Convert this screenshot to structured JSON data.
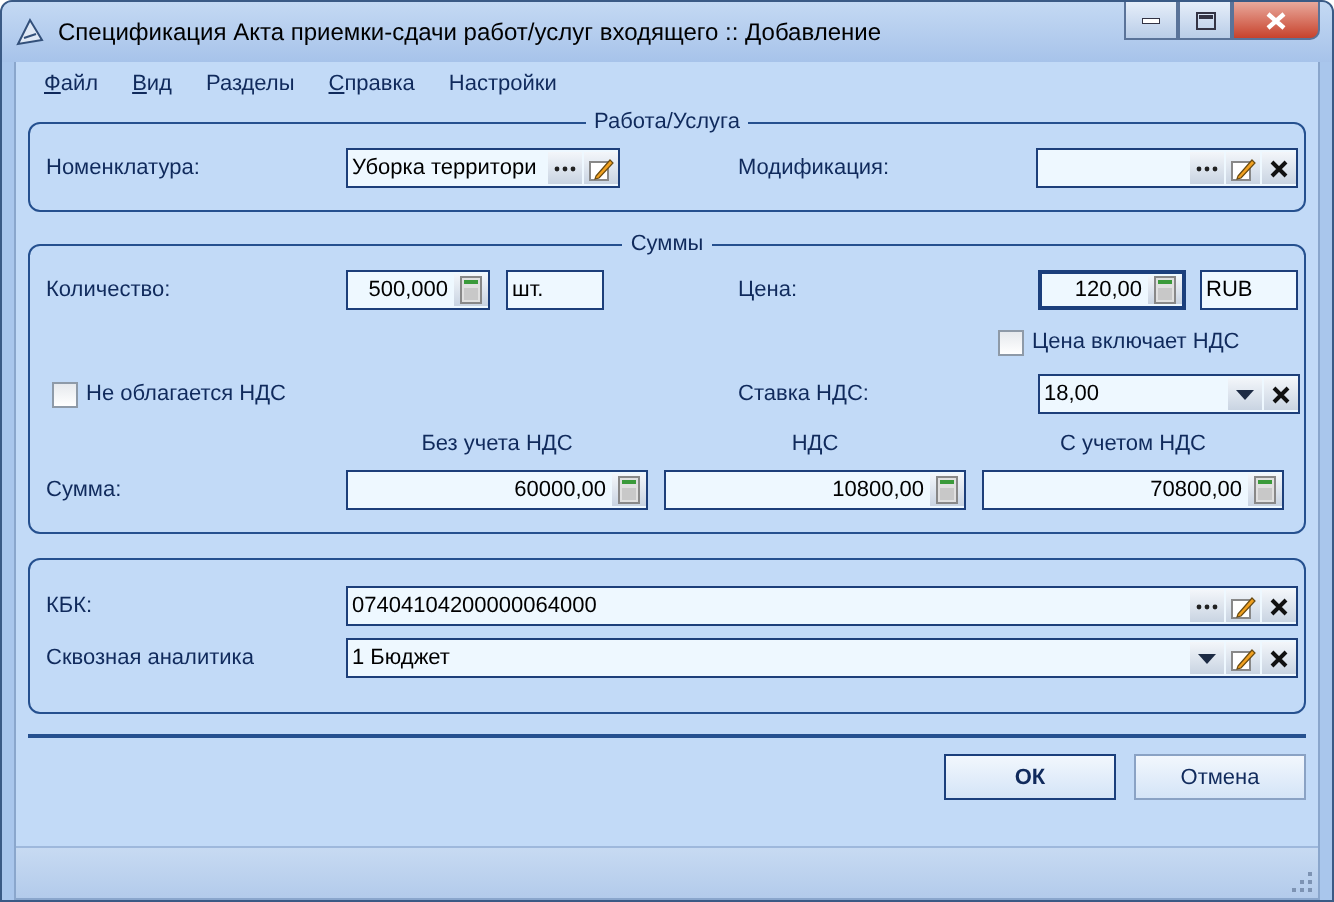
{
  "window": {
    "title": "Спецификация Акта приемки-сдачи работ/услуг входящего :: Добавление"
  },
  "menu": [
    {
      "label": "Файл",
      "underline_first": true
    },
    {
      "label": "Вид",
      "underline_first": true
    },
    {
      "label": "Разделы",
      "underline_first": false
    },
    {
      "label": "Справка",
      "underline_first": true
    },
    {
      "label": "Настройки",
      "underline_first": false
    }
  ],
  "work": {
    "title": "Работа/Услуга",
    "nomenclature": {
      "label": "Номенклатура:",
      "value": "Уборка территори",
      "buttons": [
        {
          "kind": "ellipsis"
        },
        {
          "kind": "edit"
        }
      ]
    },
    "modification": {
      "label": "Модификация:",
      "buttons": [
        {
          "kind": "ellipsis"
        },
        {
          "kind": "edit"
        },
        {
          "kind": "clear"
        }
      ]
    }
  },
  "sums": {
    "title": "Суммы",
    "quantity": {
      "label": "Количество:",
      "value": "500,000",
      "unit": "шт."
    },
    "price": {
      "label": "Цена:",
      "value": "120,00",
      "focused": true,
      "currency": "RUB"
    },
    "price_includes_vat": {
      "label": "Цена включает НДС",
      "checked": false
    },
    "vat_exempt": {
      "label": "Не облагается НДС",
      "checked": false
    },
    "vat_rate": {
      "label": "Ставка НДС:",
      "value": "18,00",
      "buttons": [
        {
          "kind": "dropdown"
        },
        {
          "kind": "clear"
        }
      ]
    },
    "amount_label": "Сумма:",
    "columns": [
      {
        "heading": "Без учета НДС",
        "value": "60000,00"
      },
      {
        "heading": "НДС",
        "value": "10800,00"
      },
      {
        "heading": "С учетом НДС",
        "value": "70800,00"
      }
    ]
  },
  "analytics": [
    {
      "label": "КБК:",
      "value": "07404104200000064000",
      "buttons": [
        {
          "kind": "ellipsis"
        },
        {
          "kind": "edit"
        },
        {
          "kind": "clear"
        }
      ]
    },
    {
      "label": "Сквозная аналитика",
      "value": "1 Бюджет",
      "buttons": [
        {
          "kind": "dropdown"
        },
        {
          "kind": "edit"
        },
        {
          "kind": "clear"
        }
      ]
    }
  ],
  "buttons": [
    {
      "label": "ОК",
      "default": true
    },
    {
      "label": "Отмена",
      "default": false
    }
  ]
}
